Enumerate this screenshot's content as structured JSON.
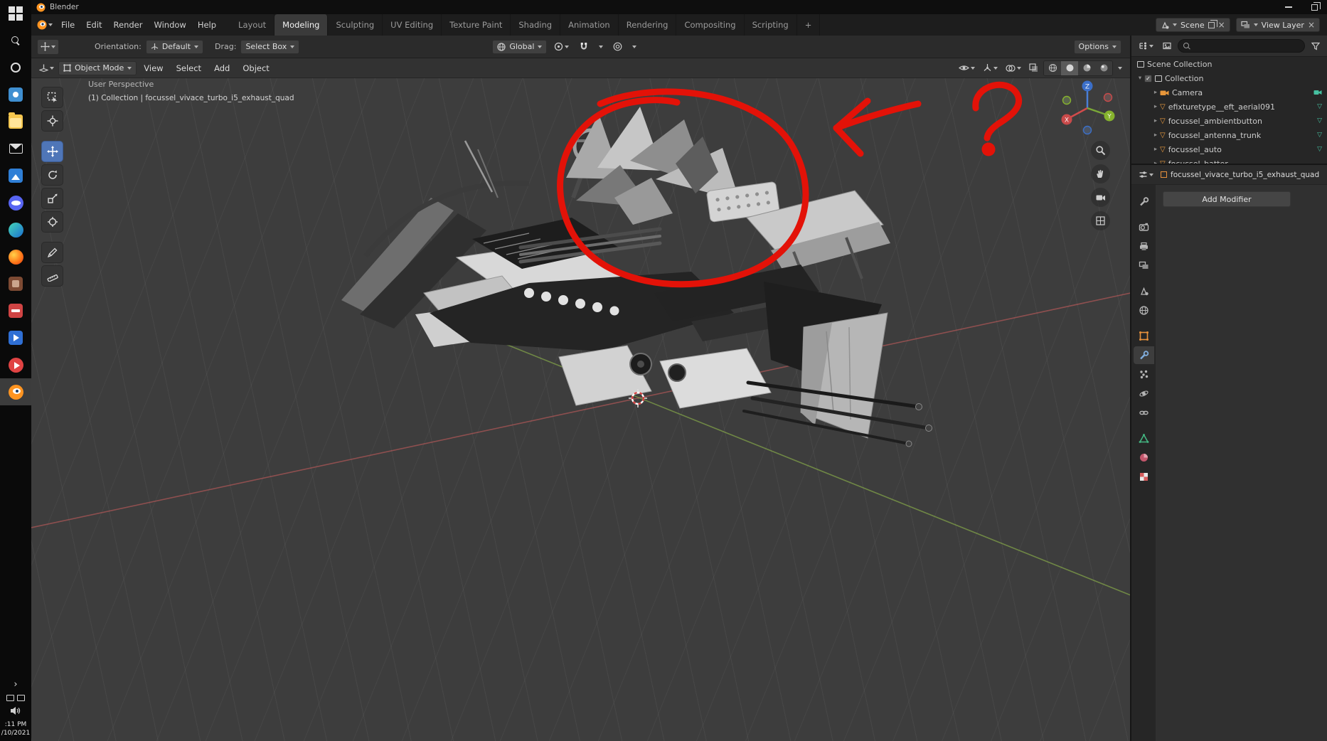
{
  "taskbar": {
    "items": [
      {
        "id": "start",
        "icon": "windows-logo-icon"
      },
      {
        "id": "search",
        "icon": "search-icon"
      },
      {
        "id": "cortana",
        "icon": "cortana-icon"
      },
      {
        "id": "app-blue",
        "icon": "app-icon"
      },
      {
        "id": "file-explorer",
        "icon": "folder-icon"
      },
      {
        "id": "mail",
        "icon": "envelope-icon"
      },
      {
        "id": "photos",
        "icon": "photos-icon"
      },
      {
        "id": "discord",
        "icon": "discord-icon"
      },
      {
        "id": "edge",
        "icon": "edge-icon"
      },
      {
        "id": "firefox",
        "icon": "firefox-icon"
      },
      {
        "id": "app-brown",
        "icon": "app-icon"
      },
      {
        "id": "app-red",
        "icon": "app-icon"
      },
      {
        "id": "movies",
        "icon": "movies-icon"
      },
      {
        "id": "media-player",
        "icon": "play-icon"
      },
      {
        "id": "blender",
        "icon": "blender-icon",
        "active": true
      }
    ],
    "expand_chevron": "›",
    "clock_time": ":11 PM",
    "clock_date": "/10/2021"
  },
  "titlebar": {
    "title": "Blender"
  },
  "topbar": {
    "menus": [
      "File",
      "Edit",
      "Render",
      "Window",
      "Help"
    ],
    "workspaces": [
      "Layout",
      "Modeling",
      "Sculpting",
      "UV Editing",
      "Texture Paint",
      "Shading",
      "Animation",
      "Rendering",
      "Compositing",
      "Scripting"
    ],
    "active_workspace": "Modeling",
    "new_workspace_tab": "+",
    "scene": {
      "label": "Scene"
    },
    "view_layer": {
      "label": "View Layer"
    }
  },
  "tool_settings": {
    "orientation_label": "Orientation:",
    "orientation_value": "Default",
    "drag_label": "Drag:",
    "drag_value": "Select Box",
    "transform_orientation": "Global",
    "options_label": "Options"
  },
  "viewport": {
    "mode": "Object Mode",
    "menus": [
      "View",
      "Select",
      "Add",
      "Object"
    ],
    "overlay_line1": "User Perspective",
    "overlay_line2": "(1) Collection | focussel_vivace_turbo_i5_exhaust_quad",
    "tools": [
      "select-box",
      "cursor",
      "move",
      "rotate",
      "scale",
      "transform",
      "annotate",
      "measure"
    ],
    "active_tool": "move",
    "side_buttons": [
      "zoom",
      "pan",
      "camera-view",
      "toggle-orthographic"
    ],
    "gizmo_axes": {
      "x": "X",
      "y": "Y",
      "z": "Z"
    }
  },
  "outliner": {
    "search_placeholder": "",
    "rows": [
      {
        "label": "Scene Collection",
        "icon": "scene-collection-icon",
        "indent": 0
      },
      {
        "label": "Collection",
        "icon": "collection-icon",
        "indent": 1,
        "checked": true
      },
      {
        "label": "Camera",
        "icon": "camera-icon",
        "indent": 2
      },
      {
        "label": "efixturetype__eft_aerial091",
        "icon": "mesh-icon",
        "indent": 2
      },
      {
        "label": "focussel_ambientbutton",
        "icon": "mesh-icon",
        "indent": 2
      },
      {
        "label": "focussel_antenna_trunk",
        "icon": "mesh-icon",
        "indent": 2
      },
      {
        "label": "focussel_auto",
        "icon": "mesh-icon",
        "indent": 2
      },
      {
        "label": "focussel_batter",
        "icon": "mesh-icon",
        "indent": 2,
        "clipped": true
      }
    ]
  },
  "properties": {
    "active_object": "focussel_vivace_turbo_i5_exhaust_quad",
    "add_modifier_label": "Add Modifier",
    "tabs": [
      "tool",
      "render",
      "output",
      "view-layer",
      "scene",
      "world",
      "object",
      "modifiers",
      "particles",
      "physics",
      "constraints",
      "object-data",
      "material",
      "texture"
    ],
    "active_tab": "modifiers"
  },
  "colors": {
    "accent_blue": "#4f76b8",
    "annotation_red": "#e31208",
    "object_orange": "#e8913c",
    "mesh_data_teal": "#46c0a0",
    "viewport_background": "#3d3d3d"
  }
}
